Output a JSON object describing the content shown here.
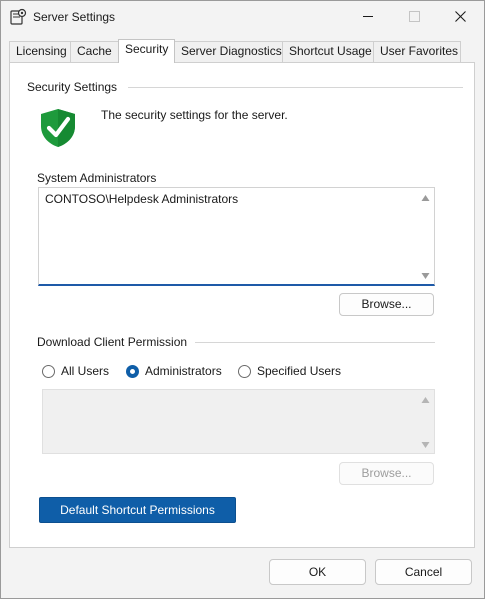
{
  "window": {
    "title": "Server Settings"
  },
  "tabs": [
    {
      "label": "Licensing"
    },
    {
      "label": "Cache"
    },
    {
      "label": "Security"
    },
    {
      "label": "Server Diagnostics"
    },
    {
      "label": "Shortcut Usage"
    },
    {
      "label": "User Favorites"
    }
  ],
  "active_tab": "Security",
  "security": {
    "group_title": "Security Settings",
    "description": "The security settings for the server.",
    "icon": "shield-check-icon",
    "admins": {
      "label": "System Administrators",
      "items": [
        "CONTOSO\\Helpdesk Administrators"
      ],
      "browse_label": "Browse..."
    },
    "download": {
      "group_title": "Download Client Permission",
      "options": [
        {
          "label": "All Users",
          "checked": false
        },
        {
          "label": "Administrators",
          "checked": true
        },
        {
          "label": "Specified Users",
          "checked": false
        }
      ],
      "browse_label": "Browse..."
    },
    "default_shortcut_label": "Default Shortcut Permissions"
  },
  "footer": {
    "ok_label": "OK",
    "cancel_label": "Cancel"
  },
  "colors": {
    "accent": "#0f5ea8",
    "shield": "#1e9a3c"
  }
}
